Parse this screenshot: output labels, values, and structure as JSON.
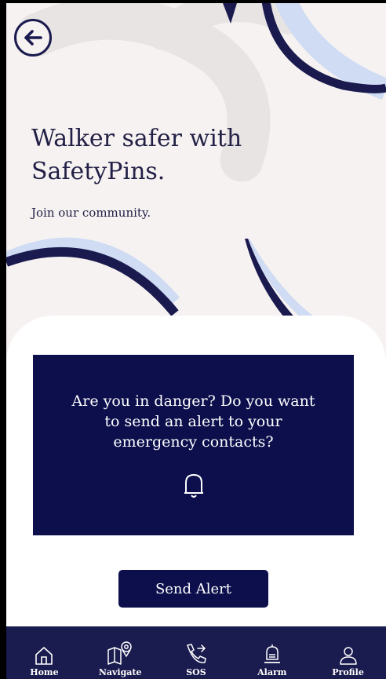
{
  "header": {
    "back_icon": "arrow-left-icon"
  },
  "hero": {
    "title": "Walker safer with SafetyPins.",
    "subtitle": "Join our community."
  },
  "alert_card": {
    "message": "Are you in danger? Do you want to send an alert to your emergency contacts?",
    "icon": "bell-icon"
  },
  "actions": {
    "send_alert_label": "Send Alert"
  },
  "bottom_nav": {
    "items": [
      {
        "label": "Home",
        "icon": "home-icon"
      },
      {
        "label": "Navigate",
        "icon": "map-pin-icon"
      },
      {
        "label": "SOS",
        "icon": "phone-call-icon"
      },
      {
        "label": "Alarm",
        "icon": "alarm-bell-icon"
      },
      {
        "label": "Profile",
        "icon": "user-icon"
      }
    ]
  },
  "colors": {
    "navy": "#0c0f4c",
    "nav_bar": "#1a1b4e",
    "background": "#f6f2f1",
    "accent_light": "#cfdcf3"
  }
}
